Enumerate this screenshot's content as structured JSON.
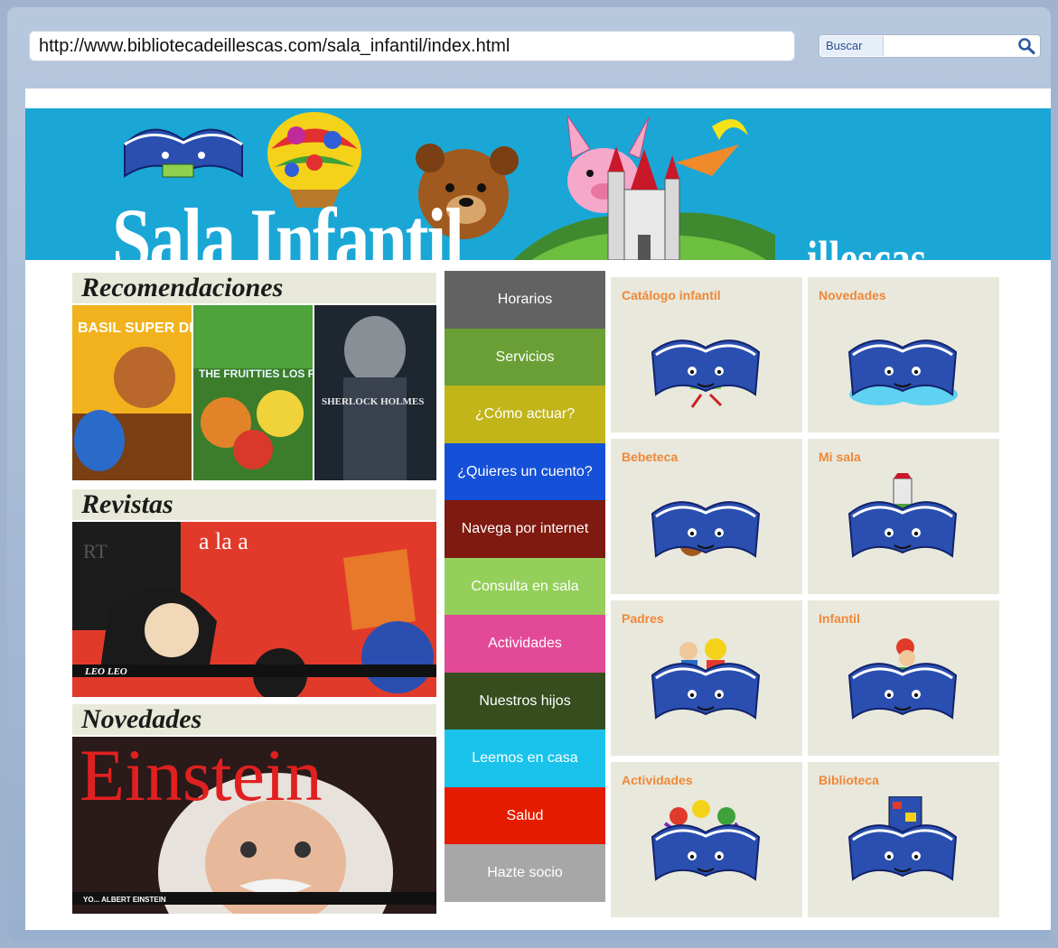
{
  "browser": {
    "url": "http://www.bibliotecadeillescas.com/sala_infantil/index.html",
    "search_label": "Buscar",
    "search_value": ""
  },
  "banner": {
    "title": "Sala Infantil",
    "subtitle": "illescas"
  },
  "sections": {
    "recomendaciones": {
      "title": "Recomendaciones",
      "covers": [
        "BASIL SUPER DETECTIVE",
        "THE FRUITTIES LOS FRUITIS",
        "SHERLOCK HOLMES"
      ]
    },
    "revistas": {
      "title": "Revistas",
      "cover_text": "a la a",
      "cover_corner": "RT",
      "cover_footer": "LEO LEO"
    },
    "novedades": {
      "title": "Novedades",
      "cover_title": "Einstein",
      "cover_footer": "YO... ALBERT EINSTEIN"
    }
  },
  "menu": [
    {
      "label": "Horarios",
      "color": "#626262"
    },
    {
      "label": "Servicios",
      "color": "#6a9f35"
    },
    {
      "label": "¿Cómo actuar?",
      "color": "#c2b51a"
    },
    {
      "label": "¿Quieres un cuento?",
      "color": "#1550d8"
    },
    {
      "label": "Navega por internet",
      "color": "#7e1a10"
    },
    {
      "label": "Consulta en sala",
      "color": "#93cf5a"
    },
    {
      "label": "Actividades",
      "color": "#e24996"
    },
    {
      "label": "Nuestros hijos",
      "color": "#364d1e"
    },
    {
      "label": "Leemos en casa",
      "color": "#19c3ec"
    },
    {
      "label": "Salud",
      "color": "#e51c00"
    },
    {
      "label": "Hazte socio",
      "color": "#a7a7a7"
    }
  ],
  "tiles": [
    {
      "label": "Catálogo infantil",
      "icon": "book-reading-icon"
    },
    {
      "label": "Novedades",
      "icon": "book-clouds-icon"
    },
    {
      "label": "Bebeteca",
      "icon": "book-toys-icon"
    },
    {
      "label": "Mi sala",
      "icon": "book-castle-icon"
    },
    {
      "label": "Padres",
      "icon": "book-family-icon"
    },
    {
      "label": "Infantil",
      "icon": "book-child-icon"
    },
    {
      "label": "Actividades",
      "icon": "book-crafts-icon"
    },
    {
      "label": "Biblioteca",
      "icon": "book-library-icon"
    }
  ],
  "colors": {
    "accent_orange": "#f08838",
    "banner_blue": "#1aa7d6",
    "book_blue": "#2a4fb0"
  }
}
